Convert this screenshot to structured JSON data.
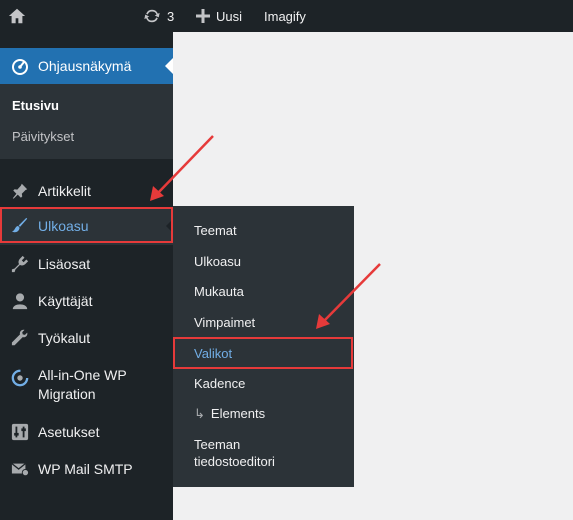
{
  "adminbar": {
    "updates_count": "3",
    "new_label": "Uusi",
    "imagify_label": "Imagify"
  },
  "sidebar": {
    "dashboard_label": "Ohjausnäkymä",
    "dashboard_sub": [
      "Etusivu",
      "Päivitykset"
    ],
    "items": [
      {
        "label": "Artikkelit",
        "icon": "pin-icon"
      },
      {
        "label": "Ulkoasu",
        "icon": "paintbrush-icon"
      },
      {
        "label": "Lisäosat",
        "icon": "plugin-icon"
      },
      {
        "label": "Käyttäjät",
        "icon": "user-icon"
      },
      {
        "label": "Työkalut",
        "icon": "wrench-icon"
      },
      {
        "label": "All-in-One WP",
        "label2": "Migration",
        "icon": "migration-icon"
      },
      {
        "label": "Asetukset",
        "icon": "settings-icon"
      },
      {
        "label": "WP Mail SMTP",
        "icon": "mail-icon"
      }
    ]
  },
  "flyout": {
    "items": [
      "Teemat",
      "Ulkoasu",
      "Mukauta",
      "Vimpaimet",
      "Valikot",
      "Kadence",
      "Elements",
      "Teeman",
      "tiedostoeditori"
    ],
    "sub_hook": "↳"
  },
  "colors": {
    "adminbar_bg": "#1d2327",
    "active_blue": "#2271b1",
    "link_blue": "#72aee6",
    "highlight_red": "#e63a3a"
  }
}
